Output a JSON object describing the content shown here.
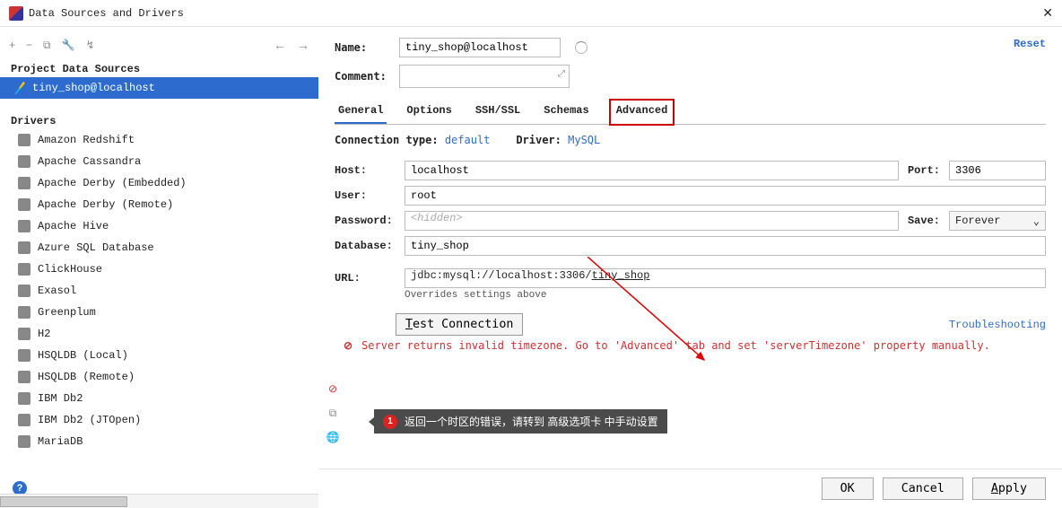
{
  "window": {
    "title": "Data Sources and Drivers"
  },
  "toolbar_icons": {
    "plus": "+",
    "minus": "−",
    "copy": "⧉",
    "wrench": "🔧",
    "undo": "↯",
    "back": "←",
    "fwd": "→"
  },
  "sections": {
    "data_sources": "Project Data Sources",
    "drivers": "Drivers"
  },
  "data_sources": [
    {
      "label": "tiny_shop@localhost",
      "selected": true
    }
  ],
  "drivers": [
    "Amazon Redshift",
    "Apache Cassandra",
    "Apache Derby (Embedded)",
    "Apache Derby (Remote)",
    "Apache Hive",
    "Azure SQL Database",
    "ClickHouse",
    "Exasol",
    "Greenplum",
    "H2",
    "HSQLDB (Local)",
    "HSQLDB (Remote)",
    "IBM Db2",
    "IBM Db2 (JTOpen)",
    "MariaDB"
  ],
  "form": {
    "name_label": "Name:",
    "name": "tiny_shop@localhost",
    "comment_label": "Comment:",
    "reset": "Reset",
    "connection_type_label": "Connection type:",
    "connection_type": "default",
    "driver_label": "Driver:",
    "driver": "MySQL",
    "host_label": "Host:",
    "host": "localhost",
    "port_label": "Port:",
    "port": "3306",
    "user_label": "User:",
    "user": "root",
    "password_label": "Password:",
    "password_placeholder": "<hidden>",
    "save_label": "Save:",
    "save_value": "Forever",
    "database_label": "Database:",
    "database": "tiny_shop",
    "url_label": "URL:",
    "url_prefix": "jdbc:mysql://localhost:3306/",
    "url_db": "tiny_shop",
    "url_note": "Overrides settings above",
    "test_btn_prefix": "T",
    "test_btn_rest": "est Connection",
    "troubleshooting": "Troubleshooting",
    "error": "Server returns invalid timezone. Go to 'Advanced' tab and set 'serverTimezone' property manually."
  },
  "tabs": [
    {
      "label": "General",
      "active": true
    },
    {
      "label": "Options",
      "active": false
    },
    {
      "label": "SSH/SSL",
      "active": false
    },
    {
      "label": "Schemas",
      "active": false
    },
    {
      "label": "Advanced",
      "active": false,
      "highlighted": true
    }
  ],
  "tooltip": {
    "badge": "1",
    "text": "返回一个时区的错误，请转到 高级选项卡 中手动设置"
  },
  "footer": {
    "ok": "OK",
    "cancel": "Cancel",
    "apply_u": "A",
    "apply_rest": "pply"
  }
}
